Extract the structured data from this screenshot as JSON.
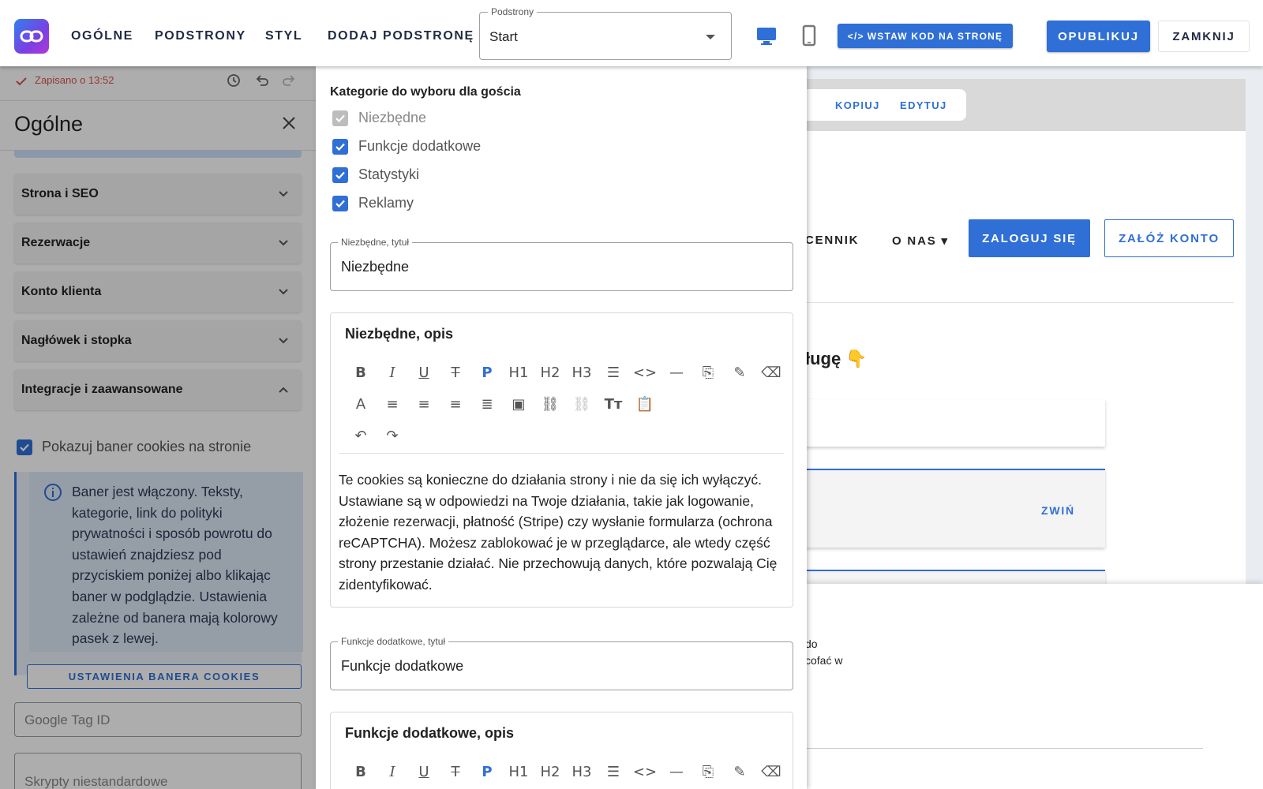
{
  "topbar": {
    "nav": [
      "OGÓLNE",
      "PODSTRONY",
      "STYL",
      "DODAJ PODSTRONĘ"
    ],
    "page_select": {
      "label": "Podstrony",
      "value": "Start"
    },
    "code_button": "WSTAW KOD NA STRONĘ",
    "publish_button": "OPUBLIKUJ",
    "close_button": "ZAMKNIJ"
  },
  "sidebar": {
    "saved_text": "Zapisano o 13:52",
    "title": "Ogólne",
    "sections": [
      "Strona i SEO",
      "Rezerwacje",
      "Konto klienta",
      "Nagłówek i stopka",
      "Integracje i zaawansowane"
    ],
    "cookie_checkbox": "Pokazuj baner cookies na stronie",
    "info_text": "Baner jest włączony. Teksty, kategorie, link do polityki prywatności i sposób powrotu do ustawień znajdziesz pod przyciskiem poniżej albo klikając baner w podglądzie. Ustawienia zależne od banera mają kolorowy pasek z lewej.",
    "banner_settings_button": "USTAWIENIA BANERA COOKIES",
    "gtag_placeholder": "Google Tag ID",
    "scripts_placeholder": "Skrypty niestandardowe"
  },
  "panel": {
    "categories_label": "Kategorie do wyboru dla gościa",
    "categories": [
      {
        "label": "Niezbędne",
        "checked": true,
        "disabled": true
      },
      {
        "label": "Funkcje dodatkowe",
        "checked": true,
        "disabled": false
      },
      {
        "label": "Statystyki",
        "checked": true,
        "disabled": false
      },
      {
        "label": "Reklamy",
        "checked": true,
        "disabled": false
      }
    ],
    "necessary_title_label": "Niezbędne, tytuł",
    "necessary_title_value": "Niezbędne",
    "necessary_desc_label": "Niezbędne, opis",
    "necessary_desc_text": "Te cookies są konieczne do działania strony i nie da się ich wyłączyć. Ustawiane są w odpowiedzi na Twoje działania, takie jak logowanie, złożenie rezerwacji, płatność (Stripe) czy wysłanie formularza (ochrona reCAPTCHA). Możesz zablokować je w przeglądarce, ale wtedy część strony przestanie działać. Nie przechowują danych, które pozwalają Cię zidentyfikować.",
    "functional_title_label": "Funkcje dodatkowe, tytuł",
    "functional_title_value": "Funkcje dodatkowe",
    "functional_desc_label": "Funkcje dodatkowe, opis",
    "toolbar_text": {
      "h1": "H1",
      "h2": "H2",
      "h3": "H3",
      "p": "P"
    }
  },
  "preview": {
    "copy_link": "KOPIUJ",
    "edit_link": "EDYTUJ",
    "nav_pricing": "CENNIK",
    "nav_about": "O NAS",
    "login_button": "ZALOGUJ SIĘ",
    "signup_button": "ZAŁÓŻ KONTO",
    "heading_fragment": "ługę 👇",
    "collapse_link": "ZWIŃ",
    "cookie_text_1": "do",
    "cookie_text_2": "cofać w"
  },
  "colors": {
    "accent": "#2f6fd6",
    "saved": "#d9534f"
  }
}
